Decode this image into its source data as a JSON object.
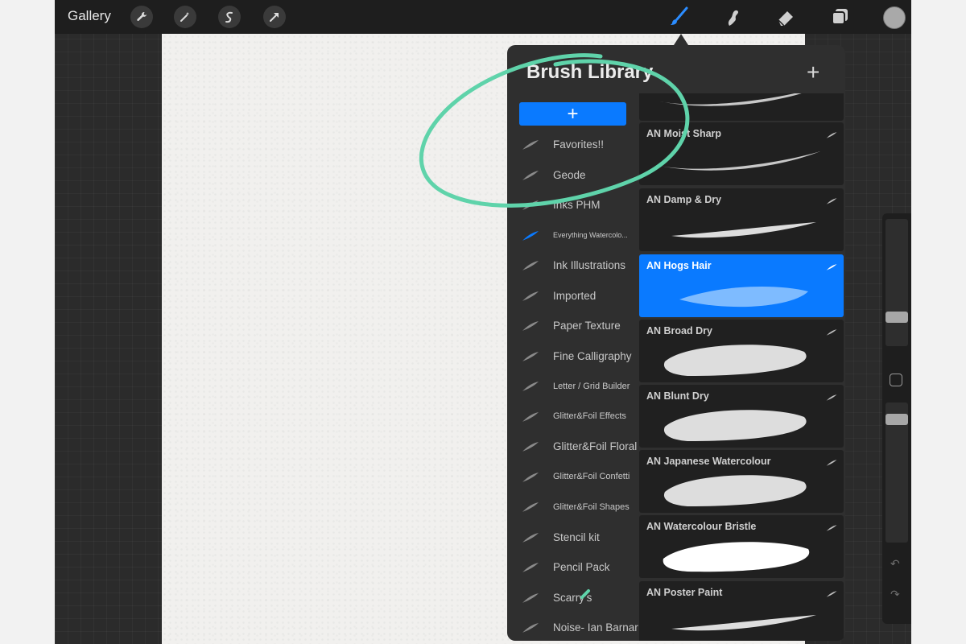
{
  "app": {
    "gallery_label": "Gallery"
  },
  "toolbar": {
    "left_tools": [
      "wrench-icon",
      "magic-wand-icon",
      "selection-icon",
      "transform-arrow-icon"
    ],
    "right_tools": [
      "brush-icon",
      "smudge-icon",
      "eraser-icon",
      "layers-icon"
    ],
    "current_color": "#a9a9a9"
  },
  "panel": {
    "title": "Brush Library",
    "add_button": "+",
    "new_set_button": "+"
  },
  "brush_sets": [
    {
      "label": "Favorites!!",
      "size": "normal",
      "active": false
    },
    {
      "label": "Geode",
      "size": "normal",
      "active": false
    },
    {
      "label": "Inks PHM",
      "size": "normal",
      "active": false
    },
    {
      "label": "Everything Watercolo...",
      "size": "tiny",
      "active": true
    },
    {
      "label": "Ink Illustrations",
      "size": "normal",
      "active": false
    },
    {
      "label": "Imported",
      "size": "normal",
      "active": false
    },
    {
      "label": "Paper Texture",
      "size": "normal",
      "active": false
    },
    {
      "label": "Fine Calligraphy",
      "size": "normal",
      "active": false
    },
    {
      "label": "Letter / Grid Builder",
      "size": "small",
      "active": false
    },
    {
      "label": "Glitter&Foil Effects",
      "size": "small",
      "active": false
    },
    {
      "label": "Glitter&Foil Floral",
      "size": "normal",
      "active": false
    },
    {
      "label": "Glitter&Foil Confetti",
      "size": "small",
      "active": false
    },
    {
      "label": "Glitter&Foil Shapes",
      "size": "small",
      "active": false
    },
    {
      "label": "Stencil kit",
      "size": "normal",
      "active": false
    },
    {
      "label": "Pencil Pack",
      "size": "normal",
      "active": false
    },
    {
      "label": "Scarry's",
      "size": "normal",
      "active": false
    },
    {
      "label": "Noise- Ian Barnard",
      "size": "normal",
      "active": false
    }
  ],
  "brushes": [
    {
      "name": "",
      "selected": false,
      "style": "wash"
    },
    {
      "name": "AN Moist Sharp",
      "selected": false,
      "style": "wash"
    },
    {
      "name": "AN Damp & Dry",
      "selected": false,
      "style": "thin"
    },
    {
      "name": "AN Hogs Hair",
      "selected": true,
      "style": "speckle"
    },
    {
      "name": "AN Broad Dry",
      "selected": false,
      "style": "dry"
    },
    {
      "name": "AN Blunt Dry",
      "selected": false,
      "style": "dry"
    },
    {
      "name": "AN Japanese Watercolour",
      "selected": false,
      "style": "dry"
    },
    {
      "name": "AN Watercolour Bristle",
      "selected": false,
      "style": "solid"
    },
    {
      "name": "AN Poster Paint",
      "selected": false,
      "style": "thin"
    }
  ],
  "colors": {
    "accent": "#0a7aff",
    "annotation": "#5fd3aa"
  }
}
